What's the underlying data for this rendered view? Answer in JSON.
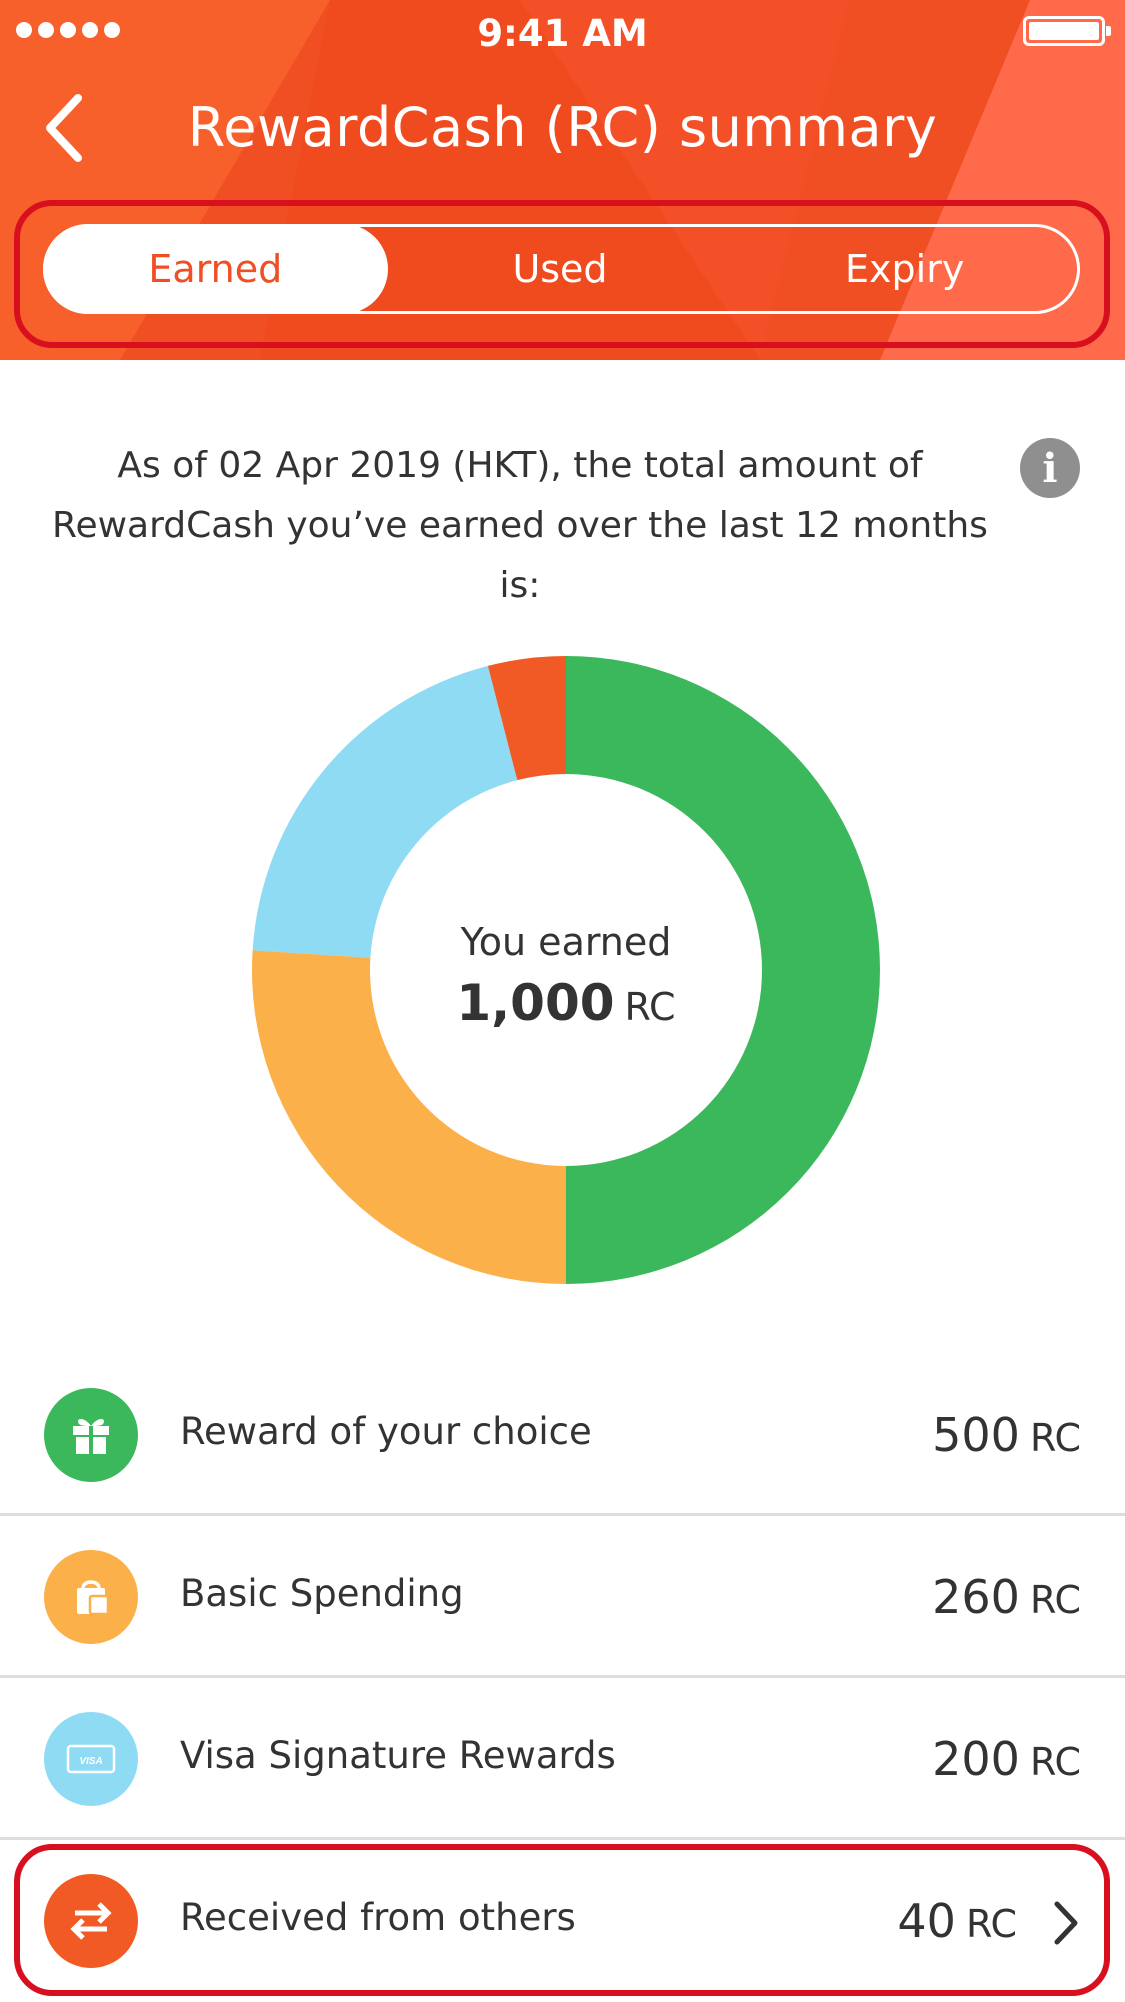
{
  "status_bar": {
    "time": "9:41 AM"
  },
  "header": {
    "title": "RewardCash (RC) summary",
    "back_icon": "chevron-left-icon"
  },
  "tabs": [
    {
      "label": "Earned",
      "active": true
    },
    {
      "label": "Used",
      "active": false
    },
    {
      "label": "Expiry",
      "active": false
    }
  ],
  "summary": {
    "intro_text": "As of 02 Apr 2019 (HKT), the total amount of RewardCash you’ve earned over the last 12 months is:",
    "info_icon": "info-icon",
    "center_label": "You earned",
    "total": "1,000",
    "unit": "RC"
  },
  "chart_data": {
    "type": "pie",
    "donut": true,
    "total": 1000,
    "slices": [
      {
        "label": "Reward of your choice",
        "value": 500,
        "color": "#3bb75c"
      },
      {
        "label": "Basic Spending",
        "value": 260,
        "color": "#fbb04a"
      },
      {
        "label": "Visa Signature Rewards",
        "value": 200,
        "color": "#8fdbf4"
      },
      {
        "label": "Received from others",
        "value": 40,
        "color": "#f15a24"
      }
    ]
  },
  "breakdown": [
    {
      "label": "Reward of your choice",
      "amount": "500",
      "unit": "RC",
      "icon": "gift-icon",
      "color": "#3bb75c"
    },
    {
      "label": "Basic Spending",
      "amount": "260",
      "unit": "RC",
      "icon": "shopping-bag-icon",
      "color": "#fbb04a"
    },
    {
      "label": "Visa Signature Rewards",
      "amount": "200",
      "unit": "RC",
      "icon": "visa-card-icon",
      "color": "#8fdbf4",
      "icon_text": "VISA"
    },
    {
      "label": "Received from others",
      "amount": "40",
      "unit": "RC",
      "icon": "transfer-icon",
      "color": "#f15a24",
      "chevron": "chevron-right-icon"
    }
  ],
  "colors": {
    "header": "#f04e23",
    "highlight": "#d80f1e",
    "text": "#333333",
    "divider": "#dddddd"
  }
}
